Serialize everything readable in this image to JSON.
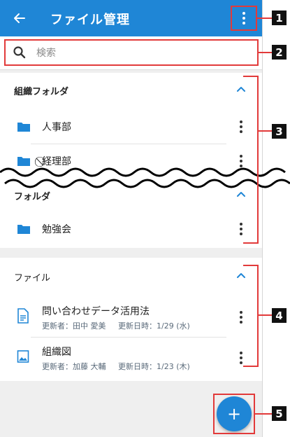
{
  "appbar": {
    "title": "ファイル管理",
    "back_icon": "arrow-left-icon",
    "more_icon": "more-vertical-icon"
  },
  "search": {
    "placeholder": "検索",
    "value": ""
  },
  "org_folders": {
    "header": "組織フォルダ",
    "items": [
      {
        "name": "人事部"
      },
      {
        "name": "⃠経理部"
      }
    ]
  },
  "folders": {
    "header": "フォルダ",
    "items": [
      {
        "name": "勉強会"
      }
    ]
  },
  "files": {
    "header": "ファイル",
    "items": [
      {
        "name": "問い合わせデータ活用法",
        "updater": "更新者：田中 愛美",
        "updated": "更新日時：1/29 (水)",
        "icon": "document-icon"
      },
      {
        "name": "組織図",
        "updater": "更新者：加藤 大輔",
        "updated": "更新日時：1/23 (木)",
        "icon": "image-icon"
      }
    ]
  },
  "fab": {
    "label": "+"
  },
  "callouts": [
    "1",
    "2",
    "3",
    "4",
    "5"
  ],
  "colors": {
    "accent": "#1f86d6",
    "callout": "#e23a3a"
  }
}
